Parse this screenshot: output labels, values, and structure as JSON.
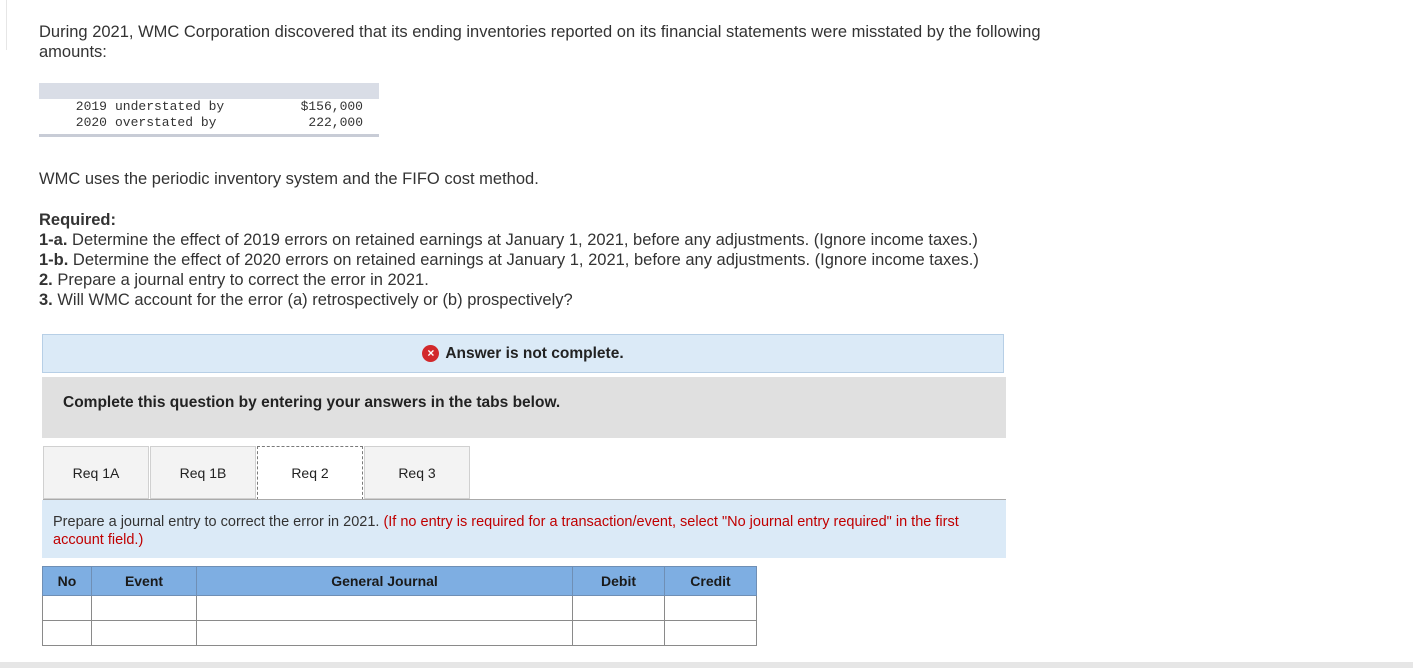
{
  "intro": "During 2021, WMC Corporation discovered that its ending inventories reported on its financial statements were misstated by the following amounts:",
  "misstatements": [
    {
      "year": "2019",
      "text": "understated by",
      "amount": "$156,000"
    },
    {
      "year": "2020",
      "text": "overstated by",
      "amount": "222,000"
    }
  ],
  "method": "WMC uses the periodic inventory system and the FIFO cost method.",
  "required": {
    "heading": "Required:",
    "items": [
      {
        "num": "1-a.",
        "text": " Determine the effect of 2019 errors on retained earnings at January 1, 2021, before any adjustments. (Ignore income taxes.)"
      },
      {
        "num": "1-b.",
        "text": " Determine the effect of 2020 errors on retained earnings at January 1, 2021, before any adjustments. (Ignore income taxes.)"
      },
      {
        "num": "2.",
        "text": " Prepare a journal entry to correct the error in 2021."
      },
      {
        "num": "3.",
        "text": " Will WMC account for the error (a) retrospectively or (b) prospectively?"
      }
    ]
  },
  "banner": {
    "icon": "×",
    "text": "Answer is not complete."
  },
  "complete_prompt": "Complete this question by entering your answers in the tabs below.",
  "tabs": [
    {
      "label": "Req 1A",
      "active": false
    },
    {
      "label": "Req 1B",
      "active": false
    },
    {
      "label": "Req 2",
      "active": true
    },
    {
      "label": "Req 3",
      "active": false
    }
  ],
  "instruction": {
    "main": "Prepare a journal entry to correct the error in 2021.",
    "note": "(If no entry is required for a transaction/event, select \"No journal entry required\" in the first account field.)"
  },
  "journal": {
    "headers": [
      "No",
      "Event",
      "General Journal",
      "Debit",
      "Credit"
    ],
    "rows": [
      [
        "",
        "",
        "",
        "",
        ""
      ],
      [
        "",
        "",
        "",
        "",
        ""
      ]
    ]
  },
  "colors": {
    "banner_bg": "#dbeaf7",
    "header_bg": "#7eaee2",
    "note_red": "#c00000",
    "error_icon": "#d2282b"
  }
}
